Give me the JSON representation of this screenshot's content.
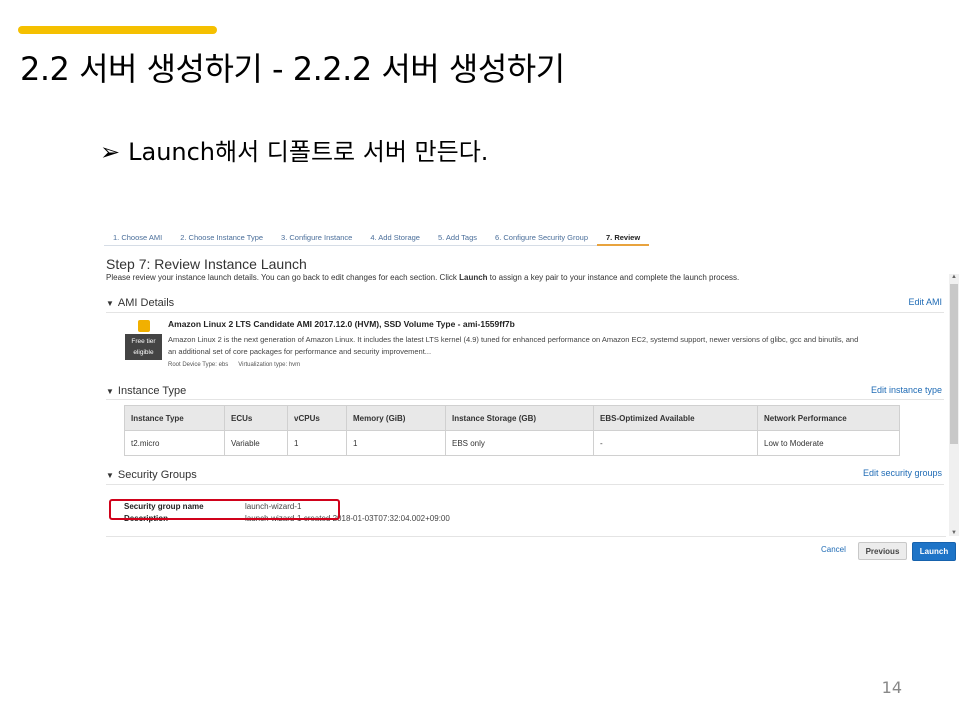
{
  "slide": {
    "title": "2.2 서버 생성하기 - 2.2.2 서버 생성하기",
    "bullet_arrow": "➢",
    "bullet_text": "Launch해서 디폴트로 서버 만든다.",
    "page_number": "14",
    "accent_color": "#f5c000"
  },
  "wizard": {
    "steps": [
      {
        "label": "1. Choose AMI"
      },
      {
        "label": "2. Choose Instance Type"
      },
      {
        "label": "3. Configure Instance"
      },
      {
        "label": "4. Add Storage"
      },
      {
        "label": "5. Add Tags"
      },
      {
        "label": "6. Configure Security Group"
      },
      {
        "label": "7. Review"
      }
    ],
    "active_step": "7. Review",
    "title": "Step 7: Review Instance Launch",
    "desc_prefix": "Please review your instance launch details. You can go back to edit changes for each section. Click ",
    "desc_bold": "Launch",
    "desc_suffix": " to assign a key pair to your instance and complete the launch process."
  },
  "ami": {
    "section": "AMI Details",
    "edit": "Edit AMI",
    "badge_line1": "Free tier",
    "badge_line2": "eligible",
    "name": "Amazon Linux 2 LTS Candidate AMI 2017.12.0 (HVM), SSD Volume Type - ami-1559ff7b",
    "desc": "Amazon Linux 2 is the next generation of Amazon Linux. It includes the latest LTS kernel (4.9) tuned for enhanced performance on Amazon EC2, systemd support, newer versions of glibc, gcc and binutils, and an additional set of core packages for performance and security improvement...",
    "root_device": "Root Device Type: ebs",
    "virtualization": "Virtualization type: hvm"
  },
  "instance": {
    "section": "Instance Type",
    "edit": "Edit instance type",
    "headers": [
      "Instance Type",
      "ECUs",
      "vCPUs",
      "Memory (GiB)",
      "Instance Storage (GB)",
      "EBS-Optimized Available",
      "Network Performance"
    ],
    "row": [
      "t2.micro",
      "Variable",
      "1",
      "1",
      "EBS only",
      "-",
      "Low to Moderate"
    ]
  },
  "security": {
    "section": "Security Groups",
    "edit": "Edit security groups",
    "name_label": "Security group name",
    "name_value": "launch-wizard-1",
    "desc_label": "Description",
    "desc_value": "launch-wizard-1 created 2018-01-03T07:32:04.002+09:00"
  },
  "actions": {
    "cancel": "Cancel",
    "previous": "Previous",
    "launch": "Launch"
  }
}
